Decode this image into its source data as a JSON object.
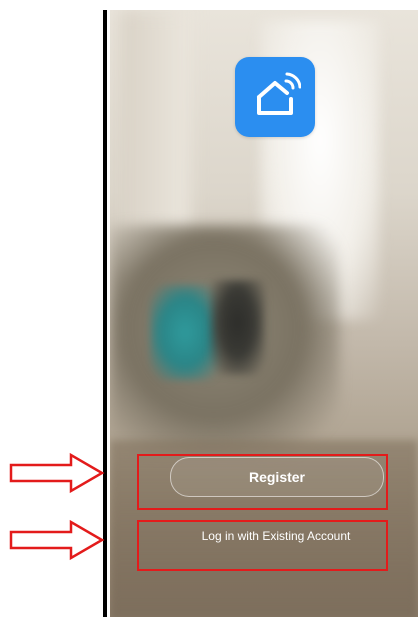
{
  "app": {
    "logo_icon": "smart-home-wifi-icon",
    "logo_color": "#2b8ef0"
  },
  "actions": {
    "register_label": "Register",
    "login_label": "Log in with Existing Account"
  },
  "annotations": {
    "highlight_color": "#e31b1b",
    "pointer_icon": "right-arrow-outline-icon"
  }
}
